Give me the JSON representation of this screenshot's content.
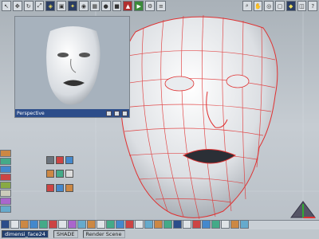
{
  "inset_viewport": {
    "title": "Perspective"
  },
  "status": {
    "object_name": "dimensi_face24",
    "shade_label": "SHADE",
    "render_scene_label": "Render Scene"
  },
  "colors": {
    "wireframe": "#e03030",
    "viewport_bg": "#b9c0c7",
    "title_bar": "#2c4d8a"
  },
  "icons": {
    "top_toolbar": [
      "arrow-icon",
      "move-icon",
      "rotate-icon",
      "scale-icon",
      "select-icon",
      "camera-icon",
      "light-icon",
      "eye-icon",
      "grid-icon",
      "sphere-icon",
      "cube-icon",
      "cone-icon",
      "render-icon",
      "settings-icon",
      "layers-icon"
    ],
    "right_toolbar": [
      "zoom-icon",
      "pan-icon",
      "orbit-icon",
      "frame-icon",
      "snap-icon",
      "layout-icon",
      "help-icon"
    ]
  }
}
